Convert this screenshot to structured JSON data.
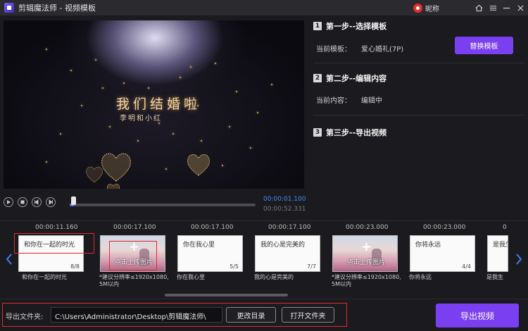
{
  "window": {
    "title": "剪辑魔法师 - 视频模板",
    "user_name": "昵称"
  },
  "player": {
    "title_text": "我们结婚啦",
    "subtitle_text": "李明和小红",
    "current_time": "00:00:01.100",
    "total_time": "00:00:52.331",
    "progress": 0.021
  },
  "steps": {
    "step1": {
      "num": "1",
      "title": "第一步--选择模板",
      "label": "当前模板：",
      "value": "爱心婚礼(7P)",
      "button": "替换模板"
    },
    "step2": {
      "num": "2",
      "title": "第二步--编辑内容",
      "label": "当前内容：",
      "value": "编辑中"
    },
    "step3": {
      "num": "3",
      "title": "第三步--导出视频"
    }
  },
  "clips": [
    {
      "time": "00:00:11.160",
      "text": "和你在一起的时光",
      "count": "8/8",
      "caption": "和你在一起的时光"
    },
    {
      "time": "00:00:17.100",
      "text": "点击上传图片",
      "count": "",
      "caption": "*建议分辨率≤1920x1080, 5M以内"
    },
    {
      "time": "00:00:17.100",
      "text": "你在我心里",
      "count": "5/5",
      "caption": "你在我心里"
    },
    {
      "time": "00:00:17.100",
      "text": "我的心是完美的",
      "count": "7/7",
      "caption": "我的心是完美的"
    },
    {
      "time": "00:00:23.000",
      "text": "点击上传图片",
      "count": "",
      "caption": "*建议分辨率≤1920x1080, 5M以内"
    },
    {
      "time": "00:00:23.000",
      "text": "你将永远",
      "count": "4/4",
      "caption": "你将永远"
    },
    {
      "time": "0",
      "text": "是我生",
      "count": "",
      "caption": "是我生"
    }
  ],
  "footer": {
    "export_label": "导出文件夹:",
    "export_path": "C:\\Users\\Administrator\\Desktop\\剪辑魔法师\\",
    "change_dir": "更改目录",
    "open_folder": "打开文件夹",
    "export_video": "导出视频"
  },
  "colors": {
    "accent": "#7b3ff2",
    "highlight": "#e02b2b",
    "progress": "#3f7cff"
  }
}
